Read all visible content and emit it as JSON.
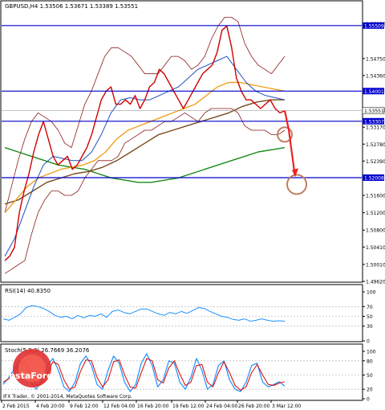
{
  "header": {
    "title": "GBPUSD,H4  1.53506 1.53671 1.53389 1.53551"
  },
  "colors": {
    "price_line": "#d00000",
    "bollinger": "#8b1a1a",
    "ma_fast": "#2050c0",
    "ma_orange": "#f0a020",
    "ma_brown": "#7a4a20",
    "ma_green": "#1a8a1a",
    "level_line": "#0000cc",
    "level_tag_bg": "#0000cc",
    "current_tag_bg": "#ffffff",
    "forecast": "#ee2222",
    "circle": "#c08060",
    "rsi_line": "#1e90ff",
    "stoch_main": "#1e90ff",
    "stoch_signal": "#dd0000"
  },
  "price_panel": {
    "scale": [
      {
        "value": 1.5555,
        "label": "1.55550"
      },
      {
        "value": 1.5475,
        "label": "1.54750"
      },
      {
        "value": 1.5436,
        "label": "1.54360"
      },
      {
        "value": 1.5357,
        "label": "1.53570"
      },
      {
        "value": 1.5317,
        "label": "1.53170"
      },
      {
        "value": 1.5278,
        "label": "1.52780"
      },
      {
        "value": 1.5239,
        "label": "1.52390"
      },
      {
        "value": 1.516,
        "label": "1.51600"
      },
      {
        "value": 1.512,
        "label": "1.51200"
      },
      {
        "value": 1.508,
        "label": "1.50800"
      },
      {
        "value": 1.5041,
        "label": "1.50410"
      },
      {
        "value": 1.5001,
        "label": "1.50010"
      },
      {
        "value": 1.4962,
        "label": "1.49620"
      }
    ],
    "levels": [
      {
        "value": 1.55509,
        "label": "1.55509"
      },
      {
        "value": 1.54001,
        "label": "1.54001"
      },
      {
        "value": 1.53307,
        "label": "1.53307"
      },
      {
        "value": 1.52008,
        "label": "1.52008"
      }
    ],
    "current": {
      "value": 1.53551,
      "label": "1.53551"
    }
  },
  "rsi_panel": {
    "title": "RSI(14) 40.8350",
    "scale": [
      {
        "value": 100,
        "label": "100"
      },
      {
        "value": 70,
        "label": "70"
      },
      {
        "value": 50,
        "label": "50"
      },
      {
        "value": 30,
        "label": "30"
      },
      {
        "value": 0,
        "label": "0"
      }
    ]
  },
  "stoch_panel": {
    "title": "Stoch(5,3,3) 26.7669 36.2076",
    "scale": [
      {
        "value": 100,
        "label": "100"
      },
      {
        "value": 80,
        "label": "80"
      },
      {
        "value": 50,
        "label": "50"
      },
      {
        "value": 20,
        "label": "20"
      },
      {
        "value": 0,
        "label": "0"
      }
    ]
  },
  "watermark": {
    "brand": "InstaForex",
    "copyright": "IFX Trader, © 2001-2014, MetaQuotes Software Corp."
  },
  "x_axis": {
    "labels": [
      "2 Feb 2015",
      "4 Feb 20:00",
      "9 Feb 12:00",
      "12 Feb 04:00",
      "16 Feb 20:00",
      "19 Feb 12:00",
      "24 Feb 04:00",
      "26 Feb 20:00",
      "3 Mar 12:00"
    ]
  },
  "chart_data": {
    "type": "line",
    "price_range": [
      1.4962,
      1.5595
    ],
    "close": [
      1.501,
      1.502,
      1.504,
      1.512,
      1.517,
      1.521,
      1.526,
      1.53,
      1.533,
      1.529,
      1.525,
      1.523,
      1.524,
      1.525,
      1.522,
      1.523,
      1.525,
      1.527,
      1.53,
      1.534,
      1.538,
      1.54,
      1.541,
      1.537,
      1.537,
      1.538,
      1.537,
      1.539,
      1.536,
      1.538,
      1.541,
      1.542,
      1.545,
      1.544,
      1.542,
      1.54,
      1.538,
      1.536,
      1.538,
      1.54,
      1.542,
      1.544,
      1.545,
      1.546,
      1.549,
      1.554,
      1.555,
      1.55,
      1.543,
      1.54,
      1.538,
      1.538,
      1.537,
      1.536,
      1.537,
      1.538,
      1.536,
      1.535,
      1.5355
    ],
    "bb_upper": [
      1.512,
      1.518,
      1.524,
      1.529,
      1.533,
      1.535,
      1.534,
      1.533,
      1.531,
      1.528,
      1.527,
      1.532,
      1.537,
      1.54,
      1.544,
      1.548,
      1.55,
      1.55,
      1.549,
      1.548,
      1.546,
      1.544,
      1.544,
      1.544,
      1.546,
      1.548,
      1.548,
      1.547,
      1.545,
      1.546,
      1.548,
      1.552,
      1.555,
      1.557,
      1.557,
      1.556,
      1.551,
      1.548,
      1.546,
      1.545,
      1.544,
      1.546,
      1.548
    ],
    "bb_lower": [
      1.498,
      1.499,
      1.5,
      1.501,
      1.507,
      1.512,
      1.515,
      1.517,
      1.517,
      1.516,
      1.516,
      1.517,
      1.52,
      1.522,
      1.524,
      1.524,
      1.524,
      1.525,
      1.528,
      1.529,
      1.53,
      1.531,
      1.531,
      1.532,
      1.533,
      1.533,
      1.534,
      1.535,
      1.534,
      1.533,
      1.535,
      1.536,
      1.536,
      1.536,
      1.536,
      1.535,
      1.532,
      1.531,
      1.531,
      1.531,
      1.53,
      1.53,
      1.531
    ],
    "ma_fast": [
      1.502,
      1.506,
      1.512,
      1.518,
      1.523,
      1.525,
      1.5245,
      1.524,
      1.524,
      1.526,
      1.53,
      1.535,
      1.538,
      1.5385,
      1.538,
      1.538,
      1.539,
      1.54,
      1.541,
      1.543,
      1.545,
      1.546,
      1.547,
      1.548,
      1.545,
      1.542,
      1.54,
      1.539,
      1.5385,
      1.538
    ],
    "ma_orange": [
      1.512,
      1.515,
      1.518,
      1.52,
      1.521,
      1.522,
      1.5225,
      1.523,
      1.524,
      1.526,
      1.529,
      1.531,
      1.532,
      1.533,
      1.534,
      1.535,
      1.536,
      1.537,
      1.539,
      1.541,
      1.542,
      1.542,
      1.5415,
      1.541,
      1.5405,
      1.54
    ],
    "ma_brown": [
      1.514,
      1.515,
      1.517,
      1.519,
      1.52,
      1.521,
      1.5215,
      1.5225,
      1.524,
      1.526,
      1.528,
      1.53,
      1.531,
      1.532,
      1.533,
      1.534,
      1.535,
      1.5365,
      1.5375,
      1.538,
      1.538
    ],
    "ma_green": [
      1.527,
      1.526,
      1.525,
      1.524,
      1.523,
      1.5225,
      1.522,
      1.521,
      1.52,
      1.5195,
      1.519,
      1.519,
      1.5195,
      1.52,
      1.521,
      1.522,
      1.523,
      1.524,
      1.525,
      1.526,
      1.5265,
      1.527
    ],
    "forecast": [
      [
        1.5355,
        1.53
      ],
      [
        1.521,
        1.52
      ]
    ],
    "rsi": [
      45,
      42,
      48,
      55,
      68,
      72,
      70,
      66,
      60,
      52,
      48,
      50,
      45,
      52,
      47,
      52,
      50,
      55,
      48,
      60,
      63,
      58,
      55,
      60,
      65,
      65,
      60,
      55,
      52,
      58,
      55,
      60,
      56,
      62,
      68,
      66,
      60,
      55,
      50,
      48,
      44,
      42,
      45,
      40,
      42,
      45,
      42,
      40,
      41,
      40
    ],
    "stoch_main": [
      30,
      45,
      62,
      80,
      75,
      35,
      20,
      40,
      70,
      85,
      60,
      25,
      15,
      35,
      75,
      90,
      70,
      30,
      20,
      60,
      90,
      75,
      35,
      15,
      30,
      75,
      95,
      70,
      25,
      40,
      80,
      75,
      35,
      20,
      45,
      85,
      60,
      20,
      30,
      70,
      80,
      40,
      20,
      15,
      35,
      70,
      75,
      35,
      25,
      30,
      36,
      27
    ],
    "stoch_signal": [
      35,
      42,
      55,
      72,
      78,
      50,
      28,
      32,
      55,
      78,
      72,
      40,
      20,
      25,
      58,
      82,
      80,
      45,
      25,
      40,
      78,
      82,
      50,
      25,
      22,
      55,
      85,
      80,
      40,
      33,
      65,
      80,
      52,
      28,
      35,
      70,
      72,
      35,
      25,
      55,
      78,
      55,
      28,
      18,
      25,
      55,
      72,
      50,
      30,
      28,
      33,
      36
    ]
  }
}
